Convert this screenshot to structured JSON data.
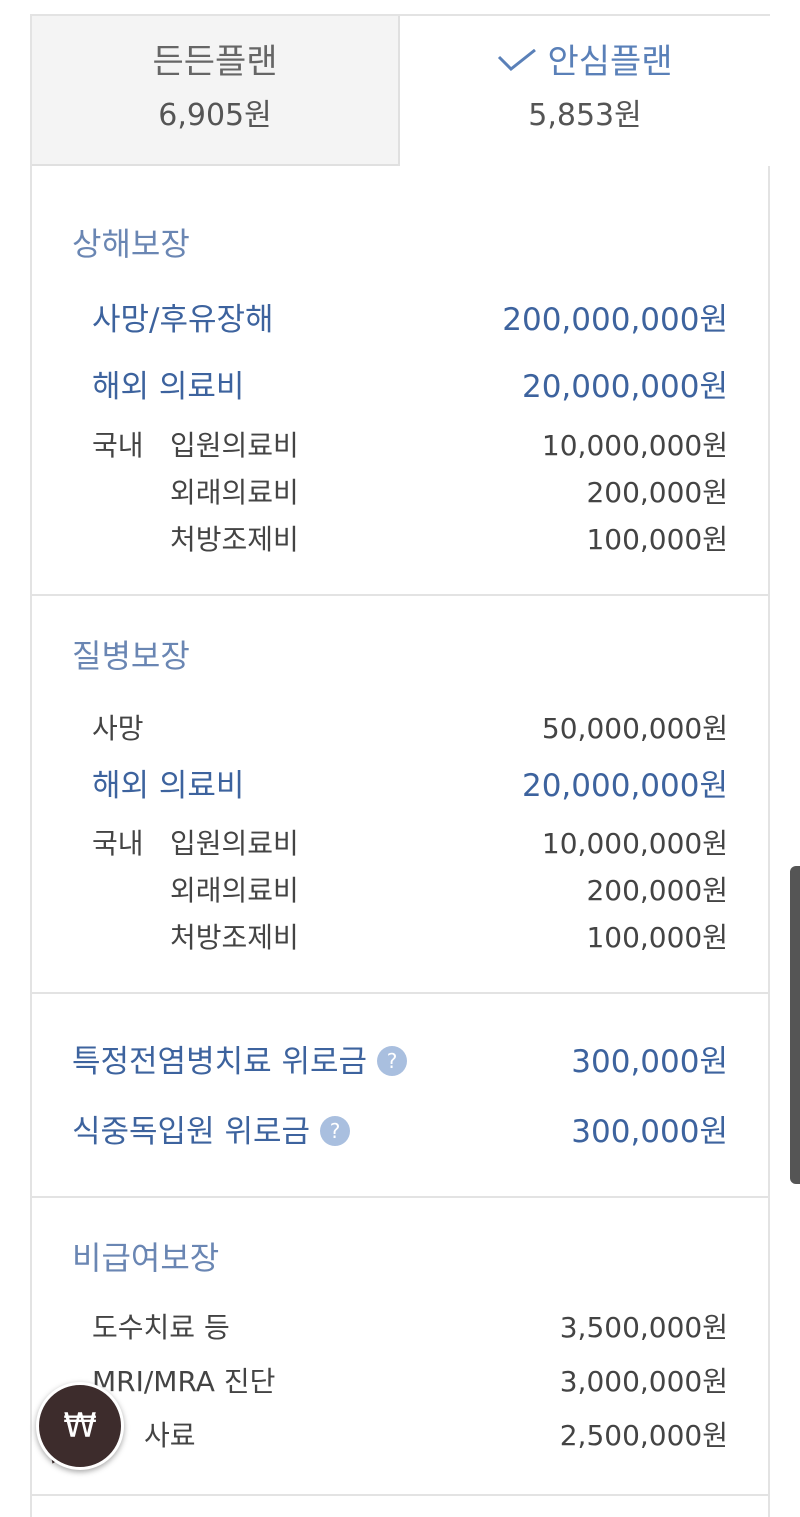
{
  "tabs": [
    {
      "name": "든든플랜",
      "price": "6,905원",
      "selected": false
    },
    {
      "name": "안심플랜",
      "price": "5,853원",
      "selected": true
    }
  ],
  "sections": {
    "injury": {
      "title": "상해보장",
      "death": {
        "label": "사망/후유장해",
        "value": "200,000,000원"
      },
      "overseas": {
        "label": "해외 의료비",
        "value": "20,000,000원"
      },
      "domestic_label": "국내",
      "inpatient": {
        "label": "입원의료비",
        "value": "10,000,000원"
      },
      "outpatient": {
        "label": "외래의료비",
        "value": "200,000원"
      },
      "prescription": {
        "label": "처방조제비",
        "value": "100,000원"
      }
    },
    "disease": {
      "title": "질병보장",
      "death": {
        "label": "사망",
        "value": "50,000,000원"
      },
      "overseas": {
        "label": "해외 의료비",
        "value": "20,000,000원"
      },
      "domestic_label": "국내",
      "inpatient": {
        "label": "입원의료비",
        "value": "10,000,000원"
      },
      "outpatient": {
        "label": "외래의료비",
        "value": "200,000원"
      },
      "prescription": {
        "label": "처방조제비",
        "value": "100,000원"
      }
    },
    "special": {
      "epidemic": {
        "label": "특정전염병치료 위로금",
        "value": "300,000원"
      },
      "food_poisoning": {
        "label": "식중독입원 위로금",
        "value": "300,000원"
      },
      "help_glyph": "?"
    },
    "non_covered": {
      "title": "비급여보장",
      "manual_therapy": {
        "label": "도수치료 등",
        "value": "3,500,000원"
      },
      "mri": {
        "label": "MRI/MRA 진단",
        "value": "3,000,000원"
      },
      "injection": {
        "label": "사료",
        "value": "2,500,000원"
      }
    }
  },
  "fab": {
    "symbol": "₩"
  },
  "colors": {
    "accent": "#3d639e",
    "title": "#6a86b3",
    "help": "#a9bfdf",
    "fab": "#3d2c2c"
  }
}
